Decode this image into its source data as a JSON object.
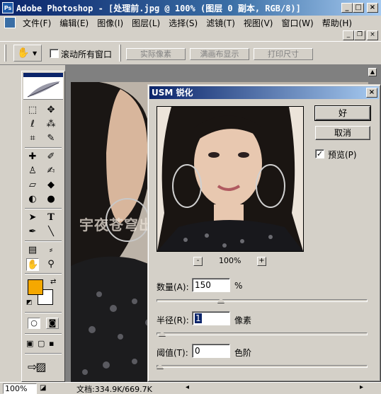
{
  "window": {
    "title": "Adobe Photoshop - [处理前.jpg @ 100% (图层 0 副本, RGB/8)]",
    "logo": "Ps",
    "minimize_icon": "_",
    "maximize_icon": "□",
    "close_icon": "×"
  },
  "menu": {
    "items": [
      "文件(F)",
      "编辑(E)",
      "图像(I)",
      "图层(L)",
      "选择(S)",
      "滤镜(T)",
      "视图(V)",
      "窗口(W)",
      "帮助(H)"
    ],
    "doc_minimize_icon": "_",
    "doc_restore_icon": "❐",
    "doc_close_icon": "×"
  },
  "options_bar": {
    "tool_icon": "hand-icon",
    "scroll_all_label": "滚动所有窗口",
    "scroll_all_checked": false,
    "actual_pixels_label": "实际像素",
    "fit_screen_label": "满画布显示",
    "print_size_label": "打印尺寸"
  },
  "document": {
    "watermark": "宇夜苍穹出品"
  },
  "dialog": {
    "title": "USM 锐化",
    "ok_label": "好",
    "cancel_label": "取消",
    "preview_label": "预览(P)",
    "preview_checked": true,
    "zoom_label": "100%",
    "zoom_minus": "-",
    "zoom_plus": "+",
    "amount": {
      "label": "数量(A):",
      "value": "150",
      "unit": "%",
      "fraction": 0.3
    },
    "radius": {
      "label": "半径(R):",
      "value": "1",
      "unit": "像素",
      "fraction": 0.01
    },
    "threshold": {
      "label": "阈值(T):",
      "value": "0",
      "unit": "色阶",
      "fraction": 0.0
    }
  },
  "statusbar": {
    "zoom": "100%",
    "doc_info": "文档:334.9K/669.7K"
  },
  "colors": {
    "foreground": "#f5a800",
    "background": "#ffffff",
    "title_active": "#0a246a"
  }
}
